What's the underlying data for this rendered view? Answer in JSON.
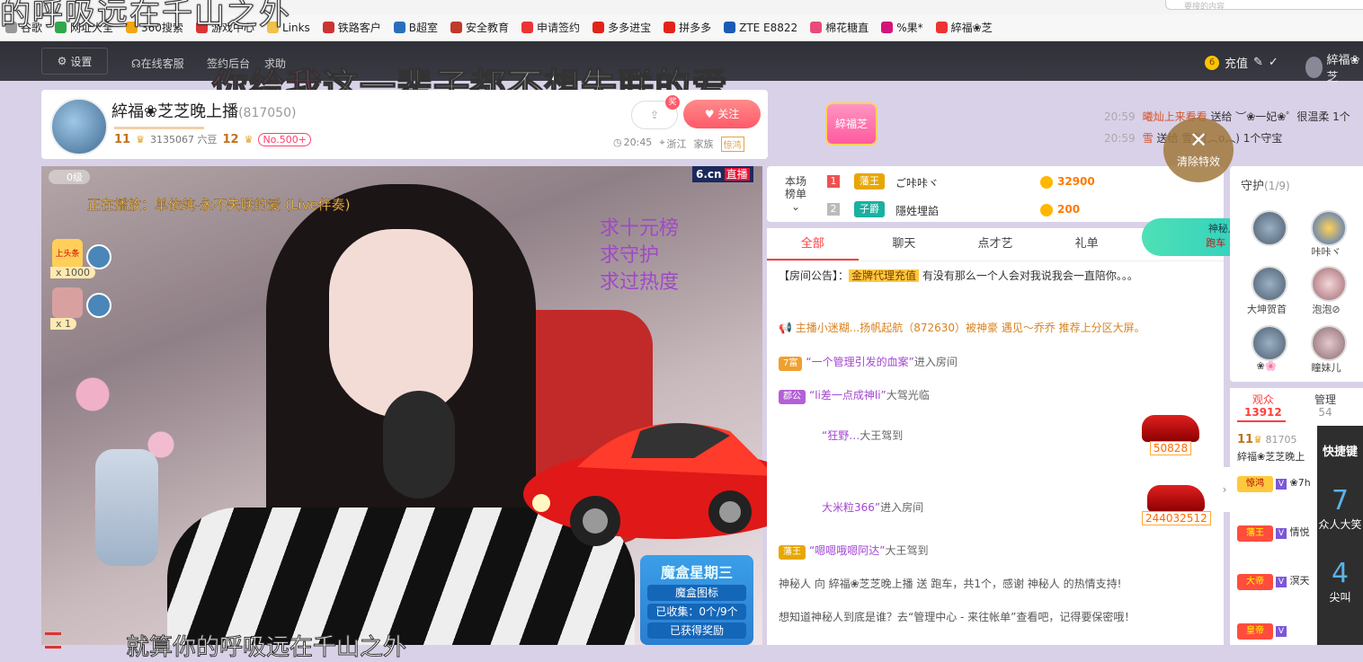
{
  "browser": {
    "lyric_overlay_top": "的呼吸远在千山之外",
    "search_placeholder": "要搜的内容",
    "search_button": "热度",
    "bookmarks": [
      {
        "label": "谷歌",
        "color": "#999"
      },
      {
        "label": "网址大全",
        "color": "#2ea84a"
      },
      {
        "label": "360搜索",
        "color": "#f3a614"
      },
      {
        "label": "游戏中心",
        "color": "#d33"
      },
      {
        "label": "Links",
        "color": "#f0c14b"
      },
      {
        "label": "铁路客户",
        "color": "#c33"
      },
      {
        "label": "B超室",
        "color": "#2a6ebb"
      },
      {
        "label": "安全教育",
        "color": "#c0392b"
      },
      {
        "label": "申请签约",
        "color": "#e33"
      },
      {
        "label": "多多进宝",
        "color": "#e2231a"
      },
      {
        "label": "拼多多",
        "color": "#e2231a"
      },
      {
        "label": "ZTE E8822",
        "color": "#1a5bb5"
      },
      {
        "label": "棉花糖直",
        "color": "#e84a7a"
      },
      {
        "label": "%果*",
        "color": "#d4147a"
      },
      {
        "label": "綷福❀芝",
        "color": "#e33"
      }
    ]
  },
  "site_nav": {
    "settings": "设置",
    "customer_service": "在线客服",
    "signing_backend": "签约后台",
    "help": "求助",
    "recharge": "充值",
    "user": "綷福❀芝"
  },
  "lyrics": {
    "main_highlight": "你给我",
    "main_rest": "这一辈子都不想失联的爱",
    "bottom": "就算你的呼吸远在千山之外"
  },
  "host": {
    "name": "綷福❀芝芝晚上播",
    "room_id": "(817050)",
    "level1": "11",
    "beans": "3135067 六豆",
    "level2": "12",
    "rank": "No.500+",
    "time": "20:45",
    "location": "浙江",
    "family": "家族",
    "family_tag": "惊鸿",
    "share_badge": "奖",
    "follow": "关注",
    "fan_badge": "綷福芝"
  },
  "ticker": [
    {
      "time": "20:59",
      "user": "曦灿上来看看",
      "action": "送给 ︶❀一妃❀゜很温柔 1个"
    },
    {
      "time": "20:59",
      "user": "雪",
      "action": "送给 雪梨(︵o︵) 1个守宝"
    }
  ],
  "video": {
    "level_text": "0级",
    "now_playing": "正在播放：单依纯-永不失联的爱 (Live伴奏)",
    "brand": "6.cn",
    "live": "直播",
    "side1_label": "上头条",
    "side1_count": "x 1000",
    "side2_count": "x 1",
    "asks": [
      "求十元榜",
      "求守护",
      "求过热度"
    ],
    "fx_title": "魔盒星期三",
    "fx_rows": [
      "魔盒图标",
      "已收集：0个/9个",
      "已获得奖励"
    ]
  },
  "rank_panel": {
    "label": "本场榜单",
    "rows": [
      {
        "num": "1",
        "badge": "藩王",
        "badge_color": "#e8a700",
        "name": "ご咔咔ヾ",
        "score": "32900"
      },
      {
        "num": "2",
        "badge": "子爵",
        "badge_color": "#1bb0a0",
        "name": "隱姓埋諂",
        "score": "200"
      }
    ]
  },
  "clear_fx": {
    "label": "清除特效"
  },
  "mystery": {
    "line1": "神秘人`",
    "line2": "跑车 1个"
  },
  "chat": {
    "tabs": [
      "全部",
      "聊天",
      "点才艺",
      "礼单",
      "活动"
    ],
    "notice_prefix": "【房间公告】：",
    "notice_link": "金牌代理充值",
    "notice_text": "有没有那么一个人会对我说我会一直陪你。。。",
    "promo": "主播小迷糊...扬帆起航（872630）被神豪 遇见～乔乔 推荐上分区大屏。",
    "lines": [
      {
        "tag": "7富",
        "tag_color": "#f0a030",
        "name": "“一个管理引发的血案”",
        "text": "进入房间"
      },
      {
        "tag": "郡公",
        "tag_color": "#b45fd8",
        "name": "“li差一点成神li”",
        "text": "大驾光临"
      },
      {
        "tag": "",
        "tag_color": "#ccc",
        "name": "“狂野…",
        "text": "大王驾到"
      },
      {
        "tag": "",
        "tag_color": "#ccc",
        "name": "大米粒366”",
        "text": "进入房间"
      },
      {
        "tag": "藩王",
        "tag_color": "#e8a700",
        "name": "“嗯嗯哦嗯阿达”",
        "text": "大王驾到"
      }
    ],
    "car1_value": "50828",
    "car2_value": "244032512",
    "gift_line": "神秘人 向 綷福❀芝芝晚上播 送 跑车，共1个，感谢 神秘人 的热情支持!",
    "mystery_line": "想知道神秘人到底是谁？去“管理中心 - 来往帐单”查看吧，记得要保密哦！"
  },
  "guards": {
    "title": "守护",
    "count": "(1/9)",
    "members": [
      {
        "name": ""
      },
      {
        "name": "咔咔ヾ"
      },
      {
        "name": "大坤贺首"
      },
      {
        "name": "泡泡⊘"
      },
      {
        "name": "❀🌸"
      },
      {
        "name": "瞳妹儿"
      }
    ]
  },
  "audience": {
    "tab1": "观众",
    "tab1_count": "13912",
    "tab2": "管理",
    "tab2_count": "54",
    "host_level": "11",
    "host_id": "81705",
    "host_name": "綷福❀芝芝晚上",
    "rows": [
      {
        "crown": "惊鸿",
        "name": "❀7h"
      },
      {
        "crown": "藩王",
        "name": "情悦"
      },
      {
        "crown": "大帝",
        "name": "溟天"
      },
      {
        "crown": "皇帝",
        "name": ""
      }
    ]
  },
  "shortcuts": {
    "title": "快捷键",
    "k1": "7",
    "k1_label": "众人大笑",
    "k2": "4",
    "k2_label": "尖叫"
  }
}
